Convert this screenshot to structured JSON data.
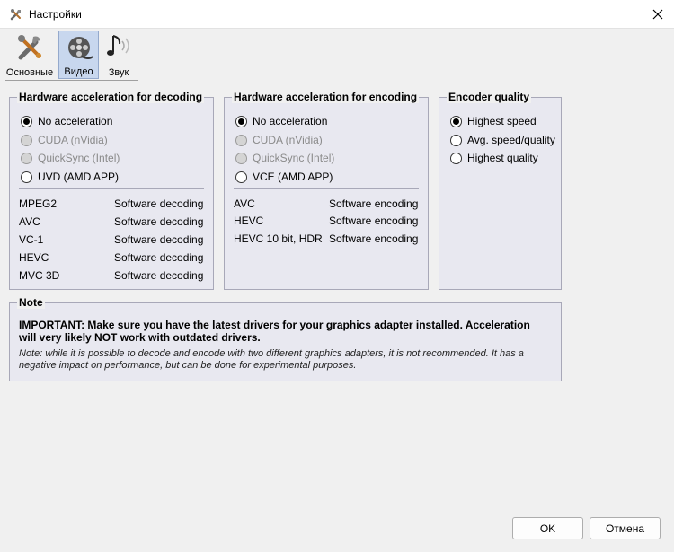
{
  "window": {
    "title": "Настройки",
    "icon": "tools-icon",
    "close_icon": "close-icon"
  },
  "toolbar": {
    "tabs": [
      {
        "label": "Основные",
        "icon": "tools-icon",
        "active": false
      },
      {
        "label": "Видео",
        "icon": "film-reel-icon",
        "active": true
      },
      {
        "label": "Звук",
        "icon": "music-note-icon",
        "active": false
      }
    ]
  },
  "decoding": {
    "title": "Hardware acceleration for decoding",
    "options": [
      {
        "label": "No acceleration",
        "checked": true,
        "disabled": false
      },
      {
        "label": "CUDA (nVidia)",
        "checked": false,
        "disabled": true
      },
      {
        "label": "QuickSync (Intel)",
        "checked": false,
        "disabled": true
      },
      {
        "label": "UVD (AMD APP)",
        "checked": false,
        "disabled": false
      }
    ],
    "rows": [
      {
        "codec": "MPEG2",
        "status": "Software decoding"
      },
      {
        "codec": "AVC",
        "status": "Software decoding"
      },
      {
        "codec": "VC-1",
        "status": "Software decoding"
      },
      {
        "codec": "HEVC",
        "status": "Software decoding"
      },
      {
        "codec": "MVC 3D",
        "status": "Software decoding"
      }
    ]
  },
  "encoding": {
    "title": "Hardware acceleration for encoding",
    "options": [
      {
        "label": "No acceleration",
        "checked": true,
        "disabled": false
      },
      {
        "label": "CUDA (nVidia)",
        "checked": false,
        "disabled": true
      },
      {
        "label": "QuickSync (Intel)",
        "checked": false,
        "disabled": true
      },
      {
        "label": "VCE (AMD APP)",
        "checked": false,
        "disabled": false
      }
    ],
    "rows": [
      {
        "codec": "AVC",
        "status": "Software encoding"
      },
      {
        "codec": "HEVC",
        "status": "Software encoding"
      },
      {
        "codec": "HEVC 10 bit, HDR",
        "status": "Software encoding"
      }
    ]
  },
  "quality": {
    "title": "Encoder quality",
    "options": [
      {
        "label": "Highest speed",
        "checked": true
      },
      {
        "label": "Avg. speed/quality",
        "checked": false
      },
      {
        "label": "Highest quality",
        "checked": false
      }
    ]
  },
  "note": {
    "title": "Note",
    "important": "IMPORTANT: Make sure you have the latest drivers for your graphics adapter installed. Acceleration will very likely NOT work with outdated drivers.",
    "detail": "Note: while it is possible to decode and encode with two different graphics adapters, it is not recommended. It has a negative impact on performance, but can be done for experimental purposes."
  },
  "buttons": {
    "ok": "OK",
    "cancel": "Отмена"
  },
  "colors": {
    "active_tab": "#c8d7ee",
    "group_bg": "#e8e8f0",
    "window_bg": "#f0f0f0"
  }
}
